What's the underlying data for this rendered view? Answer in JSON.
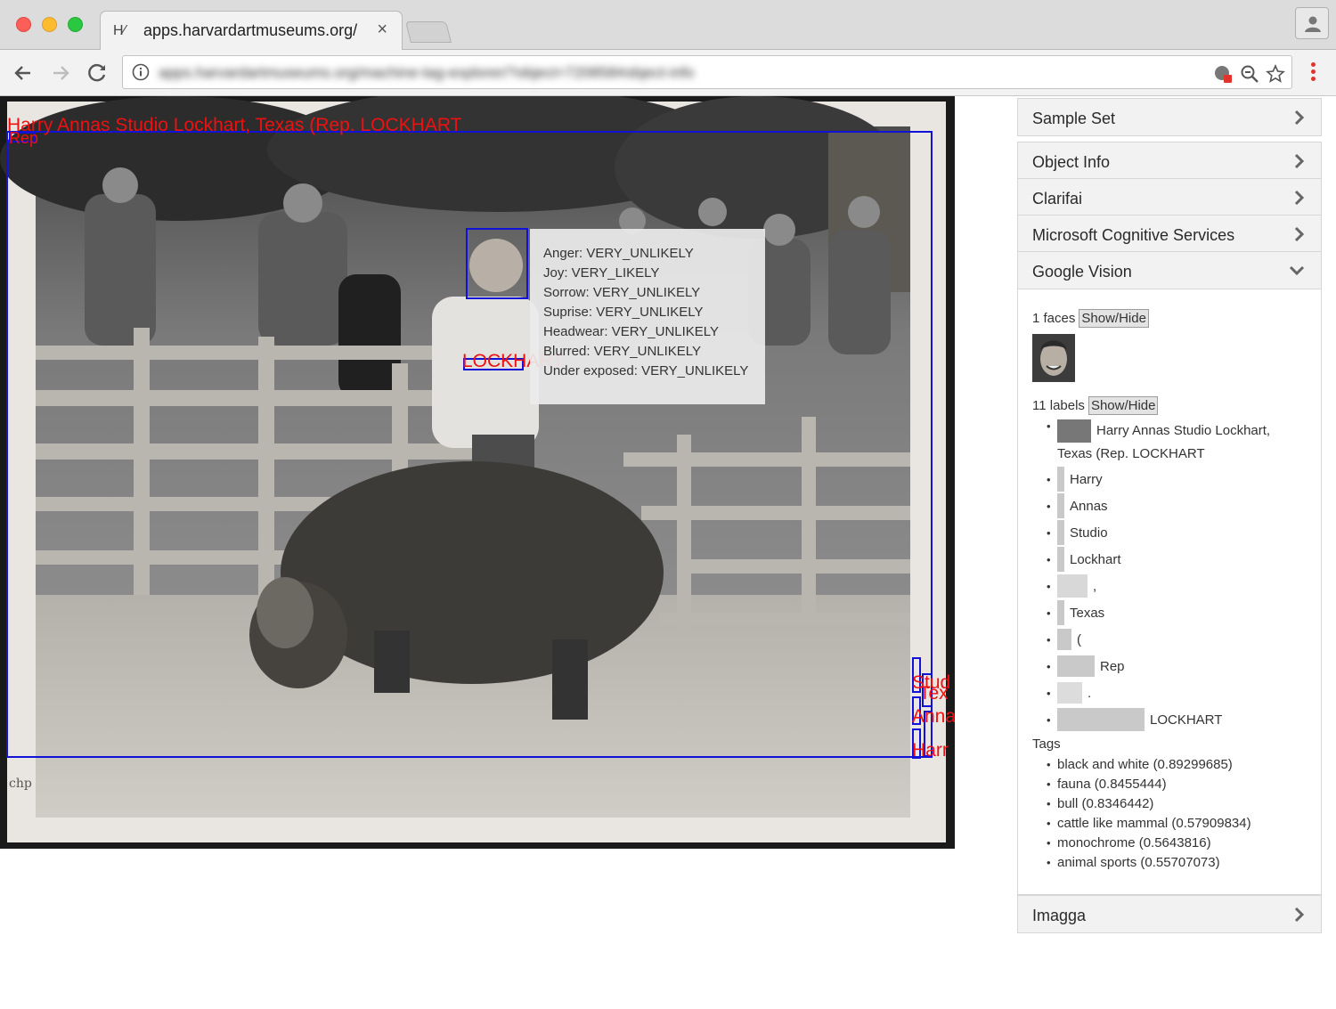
{
  "browser": {
    "tab_favicon": "H⁄",
    "tab_title": "apps.harvardartmuseums.org/",
    "address": "apps.harvardartmuseums.org/machine-tag-explorer/?object=720858#object-info"
  },
  "photo_labels": {
    "full_image_label": "Harry Annas Studio Lockhart, Texas (Rep. LOCKHART",
    "rep": "Rep",
    "lockhart": "LOCKHART",
    "edge_labels": [
      "Stud",
      "Tex",
      "Anna",
      "Harr"
    ]
  },
  "face_tooltip": [
    "Anger: VERY_UNLIKELY",
    "Joy: VERY_LIKELY",
    "Sorrow: VERY_UNLIKELY",
    "Suprise: VERY_UNLIKELY",
    "Headwear: VERY_UNLIKELY",
    "Blurred: VERY_UNLIKELY",
    "Under exposed: VERY_UNLIKELY"
  ],
  "sidebar": {
    "panels_top": [
      "Sample Set"
    ],
    "panels_mid": [
      "Object Info",
      "Clarifai",
      "Microsoft Cognitive Services"
    ],
    "google_vision": {
      "title": "Google Vision",
      "faces_count": "1 faces",
      "show_hide": "Show/Hide",
      "labels_count": "11 labels",
      "labels": [
        "Harry Annas Studio Lockhart, Texas (Rep. LOCKHART",
        "Harry",
        "Annas",
        "Studio",
        "Lockhart",
        ",",
        "Texas",
        "(",
        "Rep",
        ".",
        "LOCKHART"
      ],
      "tags_title": "Tags",
      "tags": [
        "black and white (0.89299685)",
        "fauna (0.8455444)",
        "bull (0.8346442)",
        "cattle like mammal (0.57909834)",
        "monochrome (0.5643816)",
        "animal sports (0.55707073)"
      ]
    },
    "panels_bottom": [
      "Imagga"
    ]
  },
  "colors": {
    "box": "#1111d8",
    "label": "#ee1111",
    "accent_close": "#fc5f57"
  }
}
